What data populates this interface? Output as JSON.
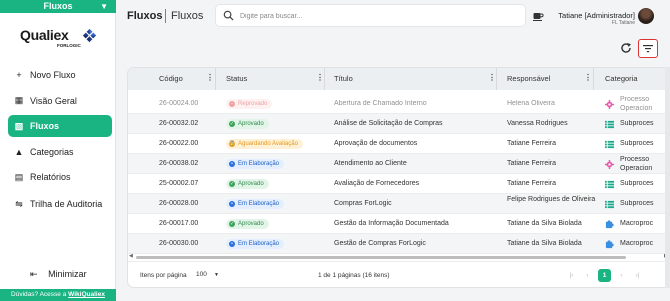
{
  "module_selector": {
    "label": "Fluxos"
  },
  "logo": {
    "name": "Qualiex",
    "sub": "FORLOGIC"
  },
  "sidebar": {
    "items": [
      {
        "label": "Novo Fluxo",
        "icon": "plus-icon"
      },
      {
        "label": "Visão Geral",
        "icon": "dashboard-icon"
      },
      {
        "label": "Fluxos",
        "icon": "flow-icon"
      },
      {
        "label": "Categorias",
        "icon": "categories-icon"
      },
      {
        "label": "Relatórios",
        "icon": "report-icon"
      },
      {
        "label": "Trilha de Auditoria",
        "icon": "audit-icon"
      }
    ],
    "minimize": "Minimizar",
    "help_prefix": "Dúvidas? Acesse a ",
    "help_link": "WikiQualiex"
  },
  "header": {
    "title": "Fluxos",
    "subtitle": "Fluxos",
    "search_placeholder": "Digite para buscar...",
    "user_name": "Tatiane [Administrador]",
    "user_role": "FL Tatiane"
  },
  "table": {
    "columns": [
      "Código",
      "Status",
      "Título",
      "Responsável",
      "Categoria"
    ],
    "rows": [
      {
        "code": "26-00024.00",
        "status": "Reprovado",
        "status_color": "red",
        "title": "Abertura de Chamado Interno",
        "owner": "Helena Oliveira",
        "category": "Processo Operacion",
        "cat_icon": "gear-icon"
      },
      {
        "code": "26-00032.02",
        "status": "Aprovado",
        "status_color": "green",
        "title": "Análise de Solicitação de Compras",
        "owner": "Vanessa Rodrigues",
        "category": "Subproces",
        "cat_icon": "list-icon"
      },
      {
        "code": "26-00022.00",
        "status": "Aguardando Avaliação",
        "status_color": "orange",
        "title": "Aprovação de documentos",
        "owner": "Tatiane Ferreira",
        "category": "Subproces",
        "cat_icon": "list-icon"
      },
      {
        "code": "26-00038.02",
        "status": "Em Elaboração",
        "status_color": "blue",
        "title": "Atendimento ao Cliente",
        "owner": "Tatiane Ferreira",
        "category": "Processo Operacion",
        "cat_icon": "gear-icon"
      },
      {
        "code": "25-00002.07",
        "status": "Aprovado",
        "status_color": "green",
        "title": "Avaliação de Fornecedores",
        "owner": "Tatiane Ferreira",
        "category": "Subproces",
        "cat_icon": "list-icon"
      },
      {
        "code": "26-00028.00",
        "status": "Em Elaboração",
        "status_color": "blue",
        "title": "Compras ForLogic",
        "owner": "Felipe Rodrigues de Oliveira",
        "category": "Subproces",
        "cat_icon": "list-icon"
      },
      {
        "code": "26-00017.00",
        "status": "Aprovado",
        "status_color": "green",
        "title": "Gestão da Informação Documentada",
        "owner": "Tatiane da Silva Biolada",
        "category": "Macroproc",
        "cat_icon": "puzzle-icon"
      },
      {
        "code": "26-00030.00",
        "status": "Em Elaboração",
        "status_color": "blue",
        "title": "Gestão de Compras ForLogic",
        "owner": "Tatiane da Silva Biolada",
        "category": "Macroproc",
        "cat_icon": "puzzle-icon"
      }
    ]
  },
  "footer": {
    "per_page_label": "Itens por página",
    "per_page_value": "100",
    "range": "1 de 1 páginas (16 itens)",
    "current_page": "1"
  },
  "colors": {
    "accent": "#19b482",
    "highlight": "#dd3333"
  }
}
